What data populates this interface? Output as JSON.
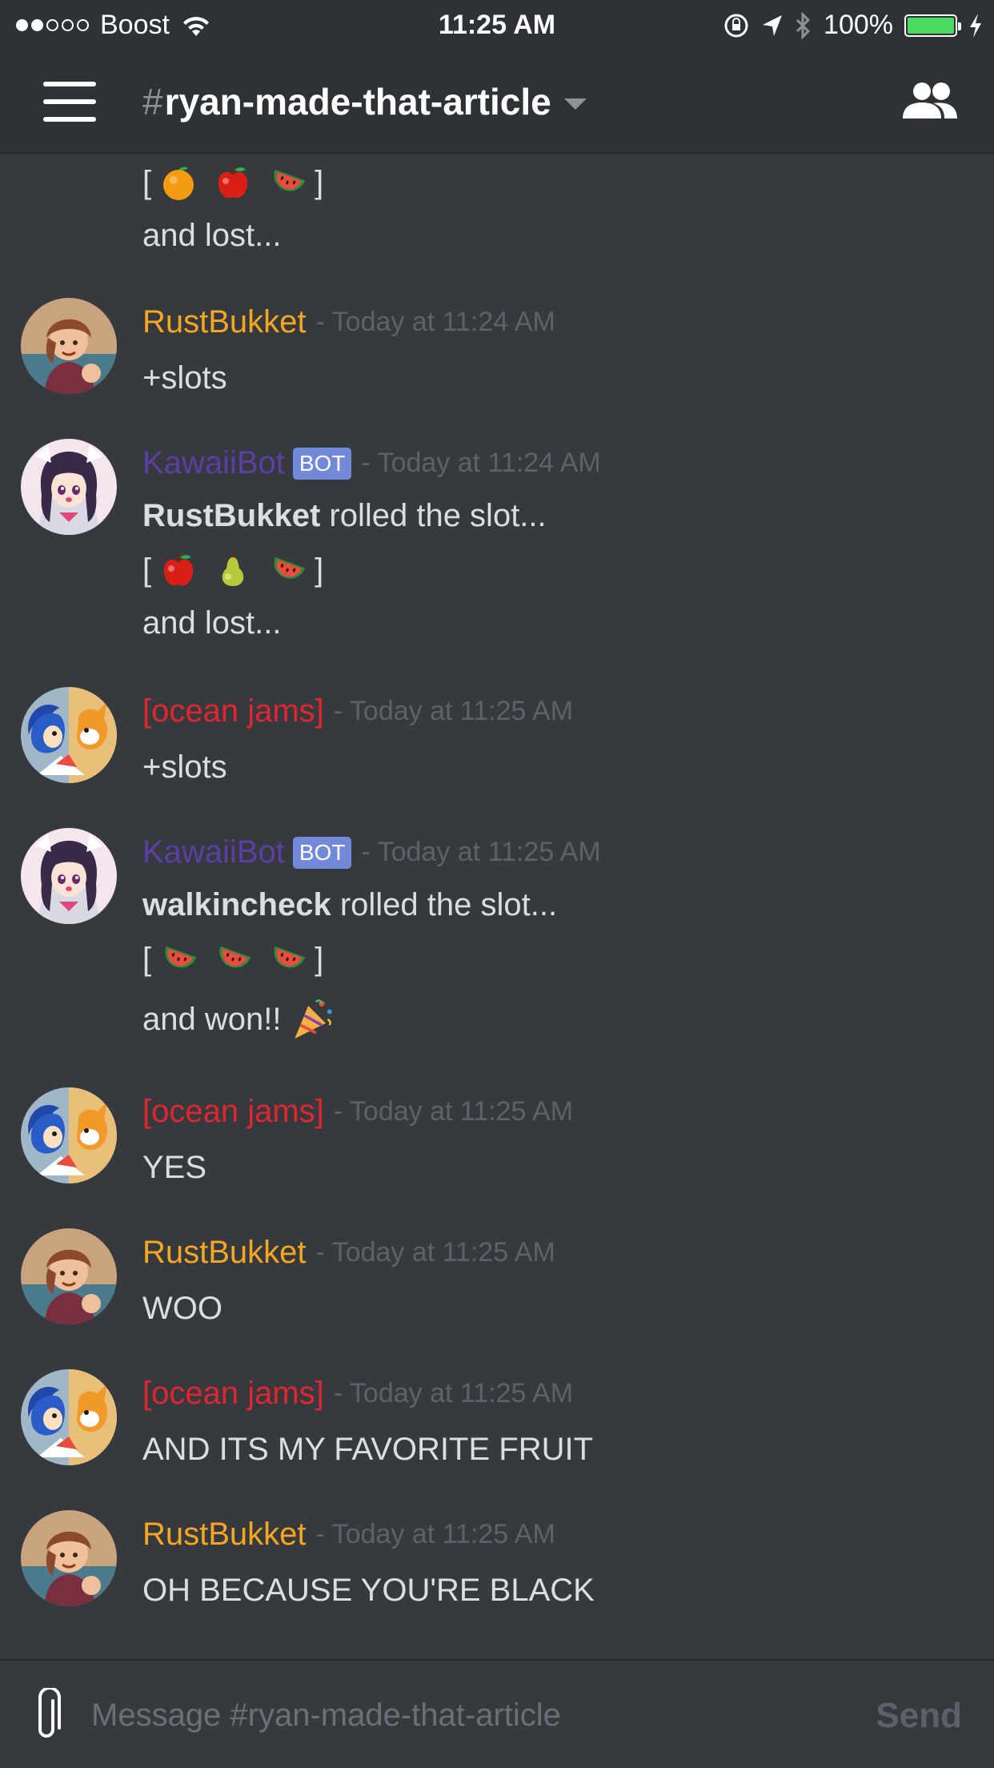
{
  "status_bar": {
    "carrier": "Boost",
    "time": "11:25 AM",
    "battery": "100%",
    "battery_level": 1.0,
    "signal_bars": 2,
    "icons": [
      "wifi-icon",
      "orientation-lock-icon",
      "location-arrow-icon",
      "bluetooth-icon",
      "battery-icon",
      "charging-bolt-icon"
    ]
  },
  "header": {
    "hash": "#",
    "channel_name": "ryan-made-that-article",
    "icons": [
      "hamburger-icon",
      "chevron-down-icon",
      "members-icon"
    ]
  },
  "colors": {
    "background": "#36393e",
    "header": "#2e3136",
    "rustbukket": "#f5a623",
    "kawaiibot": "#5b3fa6",
    "ocean_jams": "#e0262e",
    "timestamp": "#5e6268",
    "bot_tag": "#7289da"
  },
  "messages": [
    {
      "continuation": true,
      "slots": [
        "orange-emoji",
        "apple-emoji",
        "watermelon-emoji"
      ],
      "bracket_open": "[",
      "bracket_close": "]",
      "result": "and lost..."
    },
    {
      "author": "RustBukket",
      "timestamp": "- Today at 11:24 AM",
      "text": "+slots"
    },
    {
      "author": "KawaiiBot",
      "bot_tag": "BOT",
      "timestamp": "- Today at 11:24 AM",
      "roller": "RustBukket",
      "roll_text": "rolled the slot...",
      "bracket_open": "[",
      "bracket_close": "]",
      "slots": [
        "apple-emoji",
        "pear-emoji",
        "watermelon-emoji"
      ],
      "result": "and lost..."
    },
    {
      "author": "[ocean jams]",
      "timestamp": "- Today at 11:25 AM",
      "text": "+slots"
    },
    {
      "author": "KawaiiBot",
      "bot_tag": "BOT",
      "timestamp": "- Today at 11:25 AM",
      "roller": "walkincheck",
      "roll_text": "rolled the slot...",
      "bracket_open": "[",
      "bracket_close": "]",
      "slots": [
        "watermelon-emoji",
        "watermelon-emoji",
        "watermelon-emoji"
      ],
      "result": "and won!!",
      "result_emoji": "party-popper-emoji"
    },
    {
      "author": "[ocean jams]",
      "timestamp": "- Today at 11:25 AM",
      "text": "YES"
    },
    {
      "author": "RustBukket",
      "timestamp": "- Today at 11:25 AM",
      "text": "WOO"
    },
    {
      "author": "[ocean jams]",
      "timestamp": "- Today at 11:25 AM",
      "text": "AND ITS MY FAVORITE FRUIT"
    },
    {
      "author": "RustBukket",
      "timestamp": "- Today at 11:25 AM",
      "text": "OH BECAUSE YOU'RE BLACK"
    }
  ],
  "input": {
    "placeholder": "Message #ryan-made-that-article",
    "value": "",
    "send_label": "Send"
  }
}
